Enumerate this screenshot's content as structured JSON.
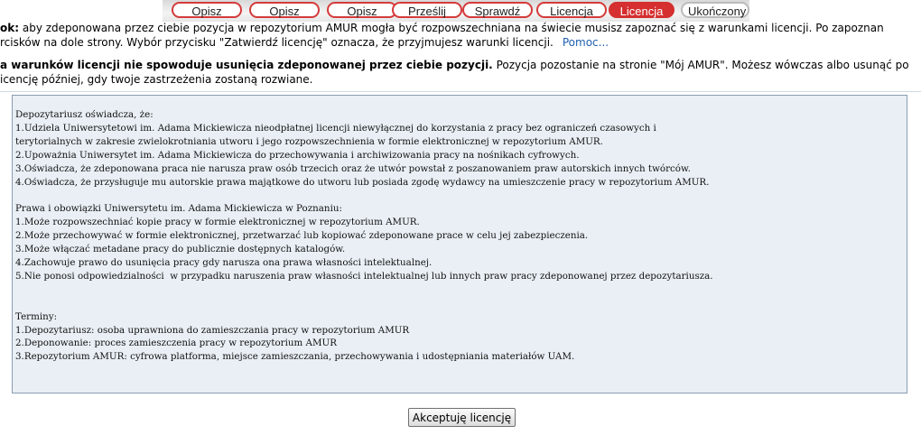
{
  "steps": [
    {
      "label": "Opisz",
      "state": "done"
    },
    {
      "label": "Opisz",
      "state": "done"
    },
    {
      "label": "Opisz",
      "state": "done"
    },
    {
      "label": "Prześlij",
      "state": "done"
    },
    {
      "label": "Sprawdź",
      "state": "done"
    },
    {
      "label": "Licencja",
      "state": "done"
    },
    {
      "label": "Licencja",
      "state": "active"
    },
    {
      "label": "Ukończony",
      "state": "pending"
    }
  ],
  "intro": {
    "bold": "ok:",
    "line1": " aby zdeponowana przez ciebie pozycja w repozytorium AMUR mogła być rozpowszechniana na świecie musisz zapoznać się z warunkami licencji. Po zapoznan",
    "line2": "rcisków na dole strony. Wybór przycisku \"Zatwierdź licencję\" oznacza, że przyjmujesz warunki licencji.",
    "help_link": "Pomoc..."
  },
  "notice": {
    "bold": "a warunków licencji nie spowoduje usunięcia zdeponowanej przez ciebie pozycji.",
    "line1_rest": " Pozycja pozostanie na stronie \"Mój AMUR\". Możesz wówczas albo usunąć po",
    "line2": "icencję później, gdy twoje zastrzeżenia zostaną rozwiane."
  },
  "license_text": "Depozytariusz oświadcza, że:\n1.Udziela Uniwersytetowi im. Adama Mickiewicza nieodpłatnej licencji niewyłącznej do korzystania z pracy bez ograniczeń czasowych i\nterytorialnych w zakresie zwielokrotniania utworu i jego rozpowszechnienia w formie elektronicznej w repozytorium AMUR.\n2.Upoważnia Uniwersytet im. Adama Mickiewicza do przechowywania i archiwizowania pracy na nośnikach cyfrowych.\n3.Oświadcza, że zdeponowana praca nie narusza praw osób trzecich oraz że utwór powstał z poszanowaniem praw autorskich innych twórców.\n4.Oświadcza, że przysługuje mu autorskie prawa majątkowe do utworu lub posiada zgodę wydawcy na umieszczenie pracy w repozytorium AMUR.\n\nPrawa i obowiązki Uniwersytetu im. Adama Mickiewicza w Poznaniu:\n1.Może rozpowszechniać kopie pracy w formie elektronicznej w repozytorium AMUR.\n2.Może przechowywać w formie elektronicznej, przetwarzać lub kopiować zdeponowane prace w celu jej zabezpieczenia.\n3.Może włączać metadane pracy do publicznie dostępnych katalogów.\n4.Zachowuje prawo do usunięcia pracy gdy narusza ona prawa własności intelektualnej.\n5.Nie ponosi odpowiedzialności  w przypadku naruszenia praw własności intelektualnej lub innych praw pracy zdeponowanej przez depozytariusza.\n\n\nTerminy:\n1.Depozytariusz: osoba uprawniona do zamieszczania pracy w repozytorium AMUR\n2.Deponowanie: proces zamieszczenia pracy w repozytorium AMUR\n3.Repozytorium AMUR: cyfrowa platforma, miejsce zamieszczania, przechowywania i udostępniania materiałów UAM.",
  "accept_button": "Akceptuję licencję",
  "colors": {
    "accent": "#d52f2f",
    "box_background": "#e9eff5",
    "link": "#2060b0"
  }
}
